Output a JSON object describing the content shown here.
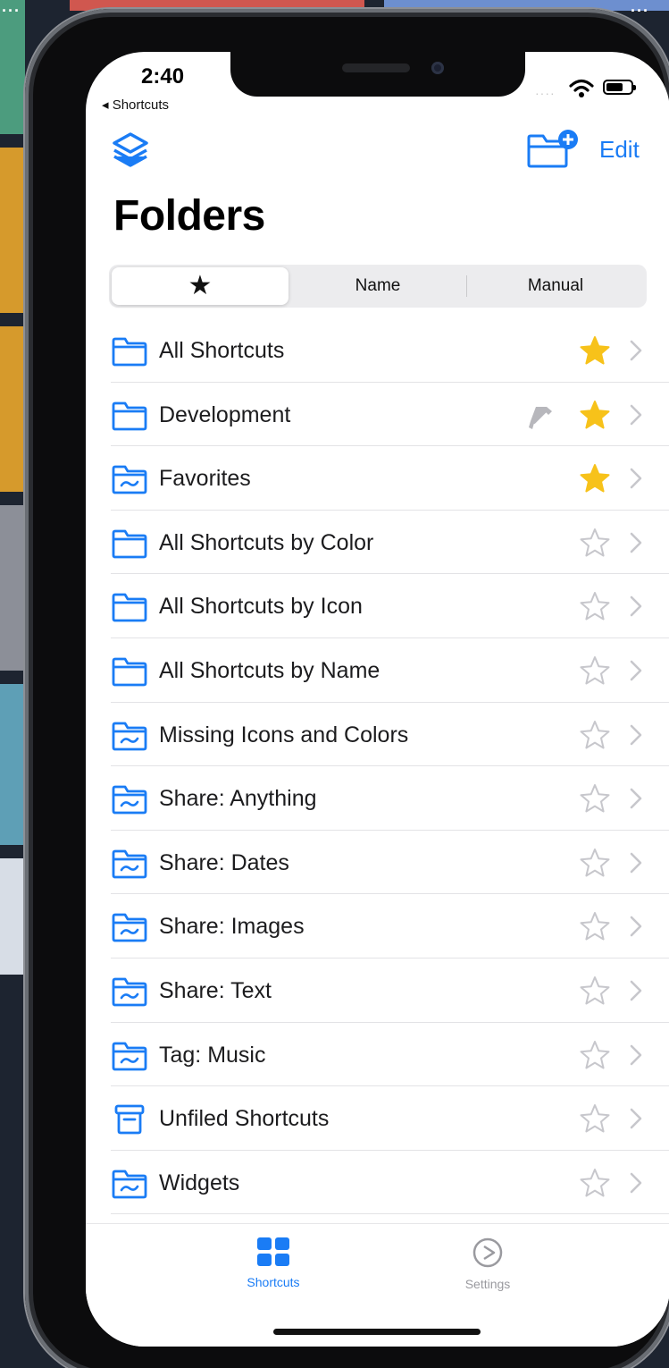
{
  "status": {
    "time": "2:40",
    "back_app": "◂ Shortcuts",
    "signal": "····"
  },
  "nav": {
    "edit_label": "Edit",
    "title": "Folders"
  },
  "segments": [
    {
      "label": "★",
      "selected": true
    },
    {
      "label": "Name",
      "selected": false
    },
    {
      "label": "Manual",
      "selected": false
    }
  ],
  "folders": [
    {
      "label": "All Shortcuts",
      "icon": "folder-icon",
      "favorite": true,
      "developer_tool": false
    },
    {
      "label": "Development",
      "icon": "folder-icon",
      "favorite": true,
      "developer_tool": true
    },
    {
      "label": "Favorites",
      "icon": "smart-folder-icon",
      "favorite": true,
      "developer_tool": false
    },
    {
      "label": "All Shortcuts by Color",
      "icon": "folder-icon",
      "favorite": false,
      "developer_tool": false
    },
    {
      "label": "All Shortcuts by Icon",
      "icon": "folder-icon",
      "favorite": false,
      "developer_tool": false
    },
    {
      "label": "All Shortcuts by Name",
      "icon": "folder-icon",
      "favorite": false,
      "developer_tool": false
    },
    {
      "label": "Missing Icons and Colors",
      "icon": "smart-folder-icon",
      "favorite": false,
      "developer_tool": false
    },
    {
      "label": "Share: Anything",
      "icon": "smart-folder-icon",
      "favorite": false,
      "developer_tool": false
    },
    {
      "label": "Share: Dates",
      "icon": "smart-folder-icon",
      "favorite": false,
      "developer_tool": false
    },
    {
      "label": "Share: Images",
      "icon": "smart-folder-icon",
      "favorite": false,
      "developer_tool": false
    },
    {
      "label": "Share: Text",
      "icon": "smart-folder-icon",
      "favorite": false,
      "developer_tool": false
    },
    {
      "label": "Tag: Music",
      "icon": "smart-folder-icon",
      "favorite": false,
      "developer_tool": false
    },
    {
      "label": "Unfiled Shortcuts",
      "icon": "archive-box-icon",
      "favorite": false,
      "developer_tool": false
    },
    {
      "label": "Widgets",
      "icon": "smart-folder-icon",
      "favorite": false,
      "developer_tool": false
    }
  ],
  "tabbar": {
    "shortcuts_label": "Shortcuts",
    "settings_label": "Settings",
    "active": "Shortcuts"
  },
  "colors": {
    "accent": "#1a7cf5",
    "star_filled": "#f7c21a",
    "star_empty": "#c7c7cc",
    "chevron": "#c7c7cc",
    "tab_inactive": "#9a9a9f"
  }
}
